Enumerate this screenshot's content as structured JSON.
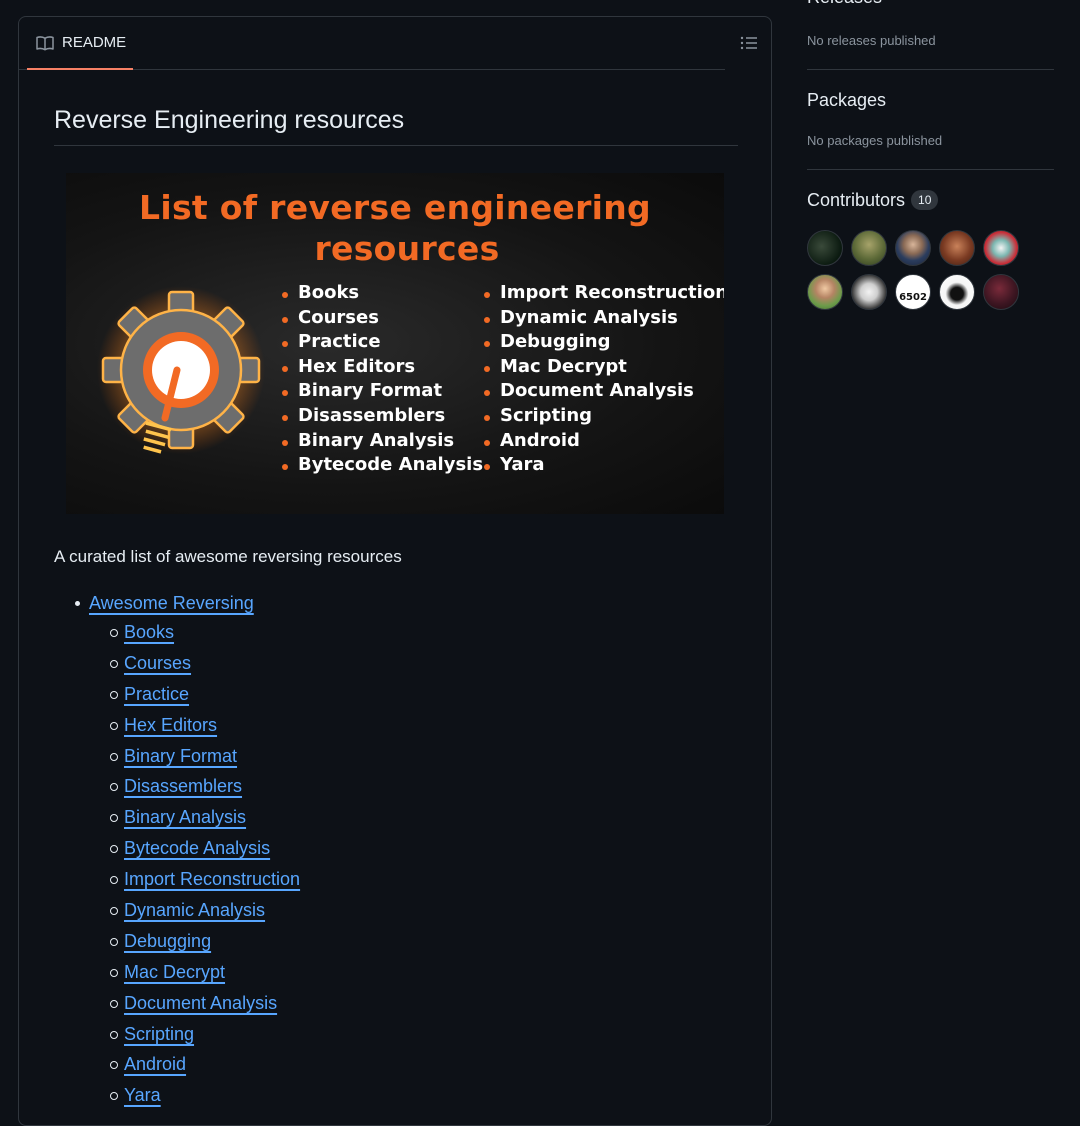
{
  "readme": {
    "tab_label": "README",
    "title": "Reverse Engineering resources",
    "banner": {
      "title_line1": "List of  reverse engineering",
      "title_line2": "resources",
      "col1": [
        "Books",
        "Courses",
        "Practice",
        "Hex Editors",
        "Binary Format",
        "Disassemblers",
        "Binary Analysis",
        "Bytecode Analysis"
      ],
      "col2": [
        "Import Reconstruction",
        "Dynamic Analysis",
        "Debugging",
        "Mac Decrypt",
        "Document Analysis",
        "Scripting",
        "Android",
        "Yara"
      ],
      "accent_color": "#f26a24"
    },
    "description": "A curated list of awesome reversing resources",
    "toc": {
      "top": "Awesome Reversing",
      "items": [
        "Books",
        "Courses",
        "Practice",
        "Hex Editors",
        "Binary Format",
        "Disassemblers",
        "Binary Analysis",
        "Bytecode Analysis",
        "Import Reconstruction",
        "Dynamic Analysis",
        "Debugging",
        "Mac Decrypt",
        "Document Analysis",
        "Scripting",
        "Android",
        "Yara"
      ]
    }
  },
  "sidebar": {
    "releases": {
      "heading": "Releases",
      "empty": "No releases published"
    },
    "packages": {
      "heading": "Packages",
      "empty": "No packages published"
    },
    "contributors": {
      "heading": "Contributors",
      "count": "10"
    },
    "avatar_badge_text": "6502"
  },
  "colors": {
    "background": "#0d1117",
    "border": "#30363d",
    "link": "#58a6ff",
    "tab_underline": "#f78166"
  },
  "icons": {
    "readme_tab": "book-icon",
    "toc": "list-unordered-icon"
  }
}
